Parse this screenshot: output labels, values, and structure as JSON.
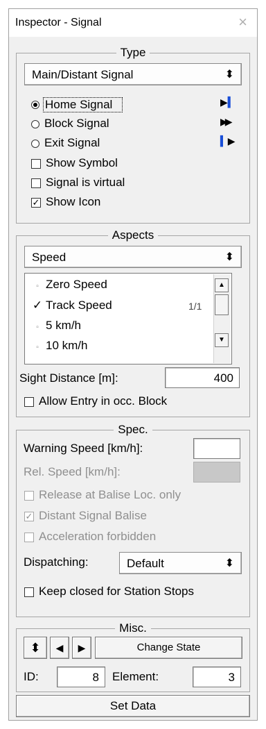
{
  "window": {
    "title": "Inspector - Signal",
    "close_symbol": "×"
  },
  "type": {
    "legend": "Type",
    "combo_value": "Main/Distant Signal",
    "combo_arrow": "⬍",
    "radios": [
      {
        "label": "Home Signal",
        "selected": true,
        "icon": "home-signal-icon",
        "icon_glyph": "▶▍"
      },
      {
        "label": "Block Signal",
        "selected": false,
        "icon": "block-signal-icon",
        "icon_glyph": "▶▶"
      },
      {
        "label": "Exit Signal",
        "selected": false,
        "icon": "exit-signal-icon",
        "icon_glyph": "▍▶"
      }
    ],
    "checkboxes": [
      {
        "label": "Show Symbol",
        "checked": false
      },
      {
        "label": "Signal is virtual",
        "checked": false
      },
      {
        "label": "Show Icon",
        "checked": true
      }
    ]
  },
  "aspects": {
    "legend": "Aspects",
    "combo_value": "Speed",
    "combo_arrow": "⬍",
    "list": [
      {
        "mark": "▫",
        "label": "Zero Speed",
        "count": ""
      },
      {
        "mark": "✓",
        "label": "Track Speed",
        "count": "1/1"
      },
      {
        "mark": "▫",
        "label": "5 km/h",
        "count": ""
      },
      {
        "mark": "▫",
        "label": "10 km/h",
        "count": ""
      }
    ],
    "sight_label": "Sight Distance [m]:",
    "sight_value": "400",
    "allow_entry_label": "Allow Entry in occ. Block",
    "allow_entry_checked": false
  },
  "spec": {
    "legend": "Spec.",
    "warning_label": "Warning Speed [km/h]:",
    "warning_value": "",
    "rel_label": "Rel. Speed [km/h]:",
    "rel_value": "",
    "release_label": "Release at Balise Loc. only",
    "distant_label": "Distant Signal Balise",
    "accel_label": "Acceleration forbidden",
    "dispatching_label": "Dispatching:",
    "dispatching_value": "Default",
    "dispatching_arrow": "⬍",
    "keep_closed_label": "Keep closed for Station Stops"
  },
  "misc": {
    "legend": "Misc.",
    "updown_glyph": "⬍",
    "left_glyph": "◀",
    "right_glyph": "▶",
    "change_state": "Change State",
    "id_label": "ID:",
    "id_value": "8",
    "element_label": "Element:",
    "element_value": "3"
  },
  "set_data": "Set Data"
}
